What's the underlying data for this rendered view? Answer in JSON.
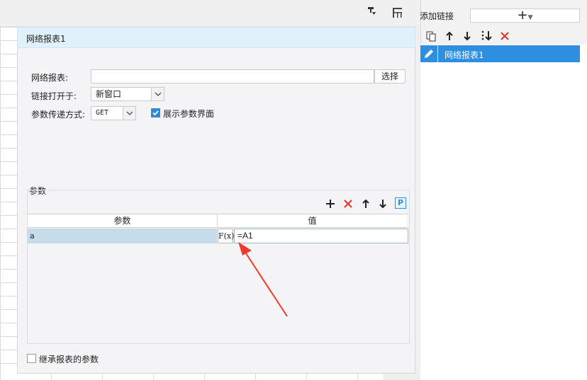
{
  "dialog": {
    "title": "网络报表1",
    "report_label": "网络报表:",
    "report_value": "",
    "select_button": "选择",
    "open_in_label": "链接打开于:",
    "open_in_value": "新窗口",
    "method_label": "参数传递方式:",
    "method_value": "GET",
    "show_params_label": "展示参数界面",
    "show_params_checked": true,
    "params_group_label": "参数",
    "params_table": {
      "columns": [
        "参数",
        "值"
      ],
      "rows": [
        {
          "param": "a",
          "formula_button": "F(x)",
          "value": "=A1"
        }
      ]
    },
    "inherit_label": "继承报表的参数",
    "inherit_checked": false
  },
  "right_panel": {
    "title": "添加链接",
    "add_symbol": "+",
    "links": [
      {
        "label": "网络报表1",
        "selected": true
      }
    ]
  },
  "icons": {
    "add": "+",
    "delete": "✕",
    "up": "↑",
    "down": "↓",
    "param": "P"
  },
  "colors": {
    "accent": "#2e8fe0",
    "delete": "#e03a2f",
    "title_bar": "#e0f1fb",
    "selected_cell": "#c7dcea",
    "annotation_arrow": "#f03b2c"
  }
}
